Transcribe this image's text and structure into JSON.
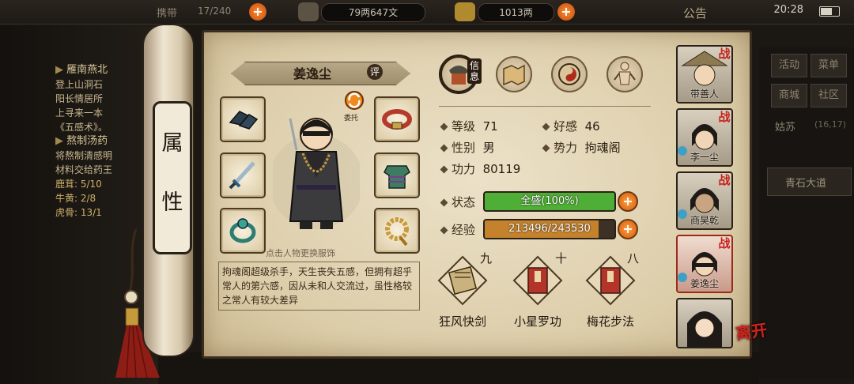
{
  "topbar": {
    "capacity_prefix": "携带",
    "capacity": "17/240",
    "money": "79两647文",
    "gold": "1013两",
    "announcement": "公告",
    "time": "20:28"
  },
  "quest_panel": {
    "title1": "雁南燕北",
    "lines1": [
      "登上山洞石",
      "阳长情居所",
      "上寻来一本",
      "《五感术》。"
    ],
    "title2": "熬制汤药",
    "lines2": [
      "将熬制清感明",
      "材料交给药王"
    ],
    "items": [
      "鹿茸: 5/10",
      "牛黄: 2/8",
      "虎骨: 13/1"
    ]
  },
  "scroll_label": [
    "属",
    "性"
  ],
  "character": {
    "name": "姜逸尘",
    "rate_badge": "评",
    "entrust_label": "委托",
    "change_tip": "点击人物更换服饰",
    "description": "拘魂阁超级杀手，天生丧失五感，但拥有超乎常人的第六感，因从未和人交流过，虽性格较之常人有较大差异"
  },
  "tabs": {
    "info_label": "信息"
  },
  "stats": {
    "level_label": "等级",
    "level": "71",
    "favor_label": "好感",
    "favor": "46",
    "gender_label": "性别",
    "gender": "男",
    "faction_label": "势力",
    "faction": "拘魂阁",
    "power_label": "功力",
    "power": "80119",
    "status_label": "状态",
    "status_text": "全盛(100%)",
    "status_fraction": 1.0,
    "exp_label": "经验",
    "exp_text": "213496/243530",
    "exp_fraction": 0.877
  },
  "skills": [
    {
      "level": "九",
      "name": "狂风快剑"
    },
    {
      "level": "十",
      "name": "小星罗功"
    },
    {
      "level": "八",
      "name": "梅花步法"
    }
  ],
  "team": [
    {
      "name": "带善人",
      "zhan": "战"
    },
    {
      "name": "李一尘",
      "zhan": "战"
    },
    {
      "name": "商昊乾",
      "zhan": "战"
    },
    {
      "name": "姜逸尘",
      "zhan": "战"
    },
    {
      "name": "",
      "zhan": ""
    }
  ],
  "leave": "离开",
  "right_menu": {
    "activity": "活动",
    "menu": "菜单",
    "shop": "商城",
    "community": "社区",
    "location": "姑苏",
    "coords": "(16,17)",
    "place": "青石大道"
  },
  "colors": {
    "status_fill": "#4fae35",
    "exp_fill": "#c4822d",
    "accent_orange": "#e36a14",
    "zhan_red": "#c6221b"
  }
}
